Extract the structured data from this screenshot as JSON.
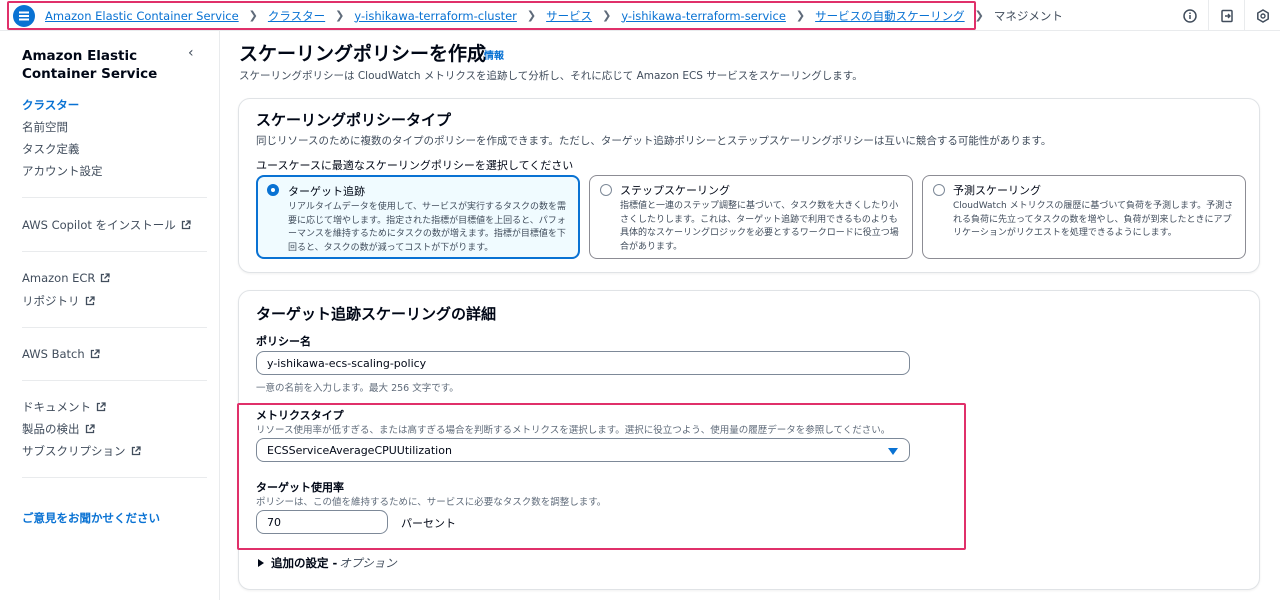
{
  "breadcrumbs": {
    "items": [
      {
        "label": "Amazon Elastic Container Service"
      },
      {
        "label": "クラスター"
      },
      {
        "label": "y-ishikawa-terraform-cluster"
      },
      {
        "label": "サービス"
      },
      {
        "label": "y-ishikawa-terraform-service"
      },
      {
        "label": "サービスの自動スケーリング"
      }
    ],
    "current": "マネジメント"
  },
  "top_icons": [
    "info-icon",
    "export-icon",
    "settings-icon"
  ],
  "sidebar": {
    "title": "Amazon Elastic Container Service",
    "groups": [
      {
        "items": [
          {
            "label": "クラスター",
            "active": true
          },
          {
            "label": "名前空間"
          },
          {
            "label": "タスク定義"
          },
          {
            "label": "アカウント設定"
          }
        ]
      },
      {
        "items": [
          {
            "label": "AWS Copilot をインストール",
            "external": true
          }
        ]
      },
      {
        "items": [
          {
            "label": "Amazon ECR",
            "external": true
          },
          {
            "label": "リポジトリ",
            "external": true
          }
        ]
      },
      {
        "items": [
          {
            "label": "AWS Batch",
            "external": true
          }
        ]
      },
      {
        "items": [
          {
            "label": "ドキュメント",
            "external": true
          },
          {
            "label": "製品の検出",
            "external": true
          },
          {
            "label": "サブスクリプション",
            "external": true
          }
        ]
      }
    ],
    "feedback": "ご意見をお聞かせください"
  },
  "page": {
    "title": "スケーリングポリシーを作成",
    "info": "情報",
    "description": "スケーリングポリシーは CloudWatch メトリクスを追跡して分析し、それに応じて Amazon ECS サービスをスケーリングします。"
  },
  "policy_type": {
    "title": "スケーリングポリシータイプ",
    "description": "同じリソースのために複数のタイプのポリシーを作成できます。ただし、ターゲット追跡ポリシーとステップスケーリングポリシーは互いに競合する可能性があります。",
    "prompt": "ユースケースに最適なスケーリングポリシーを選択してください",
    "options": [
      {
        "title": "ターゲット追跡",
        "selected": true,
        "description": "リアルタイムデータを使用して、サービスが実行するタスクの数を需要に応じて増やします。指定された指標が目標値を上回ると、パフォーマンスを維持するためにタスクの数が増えます。指標が目標値を下回ると、タスクの数が減ってコストが下がります。"
      },
      {
        "title": "ステップスケーリング",
        "selected": false,
        "description": "指標値と一連のステップ調整に基づいて、タスク数を大きくしたり小さくしたりします。これは、ターゲット追跡で利用できるものよりも具体的なスケーリングロジックを必要とするワークロードに役立つ場合があります。"
      },
      {
        "title": "予測スケーリング",
        "selected": false,
        "description": "CloudWatch メトリクスの履歴に基づいて負荷を予測します。予測される負荷に先立ってタスクの数を増やし、負荷が到来したときにアプリケーションがリクエストを処理できるようにします。"
      }
    ]
  },
  "details": {
    "title": "ターゲット追跡スケーリングの詳細",
    "policy_name": {
      "label": "ポリシー名",
      "value": "y-ishikawa-ecs-scaling-policy",
      "hint": "一意の名前を入力します。最大 256 文字です。"
    },
    "metric_type": {
      "label": "メトリクスタイプ",
      "hint": "リソース使用率が低すぎる、または高すぎる場合を判断するメトリクスを選択します。選択に役立つよう、使用量の履歴データを参照してください。",
      "value": "ECSServiceAverageCPUUtilization"
    },
    "target": {
      "label": "ターゲット使用率",
      "hint": "ポリシーは、この値を維持するために、サービスに必要なタスク数を調整します。",
      "value": "70",
      "unit": "パーセント"
    },
    "additional": {
      "label": "追加の設定 -",
      "optional": "オプション"
    }
  }
}
